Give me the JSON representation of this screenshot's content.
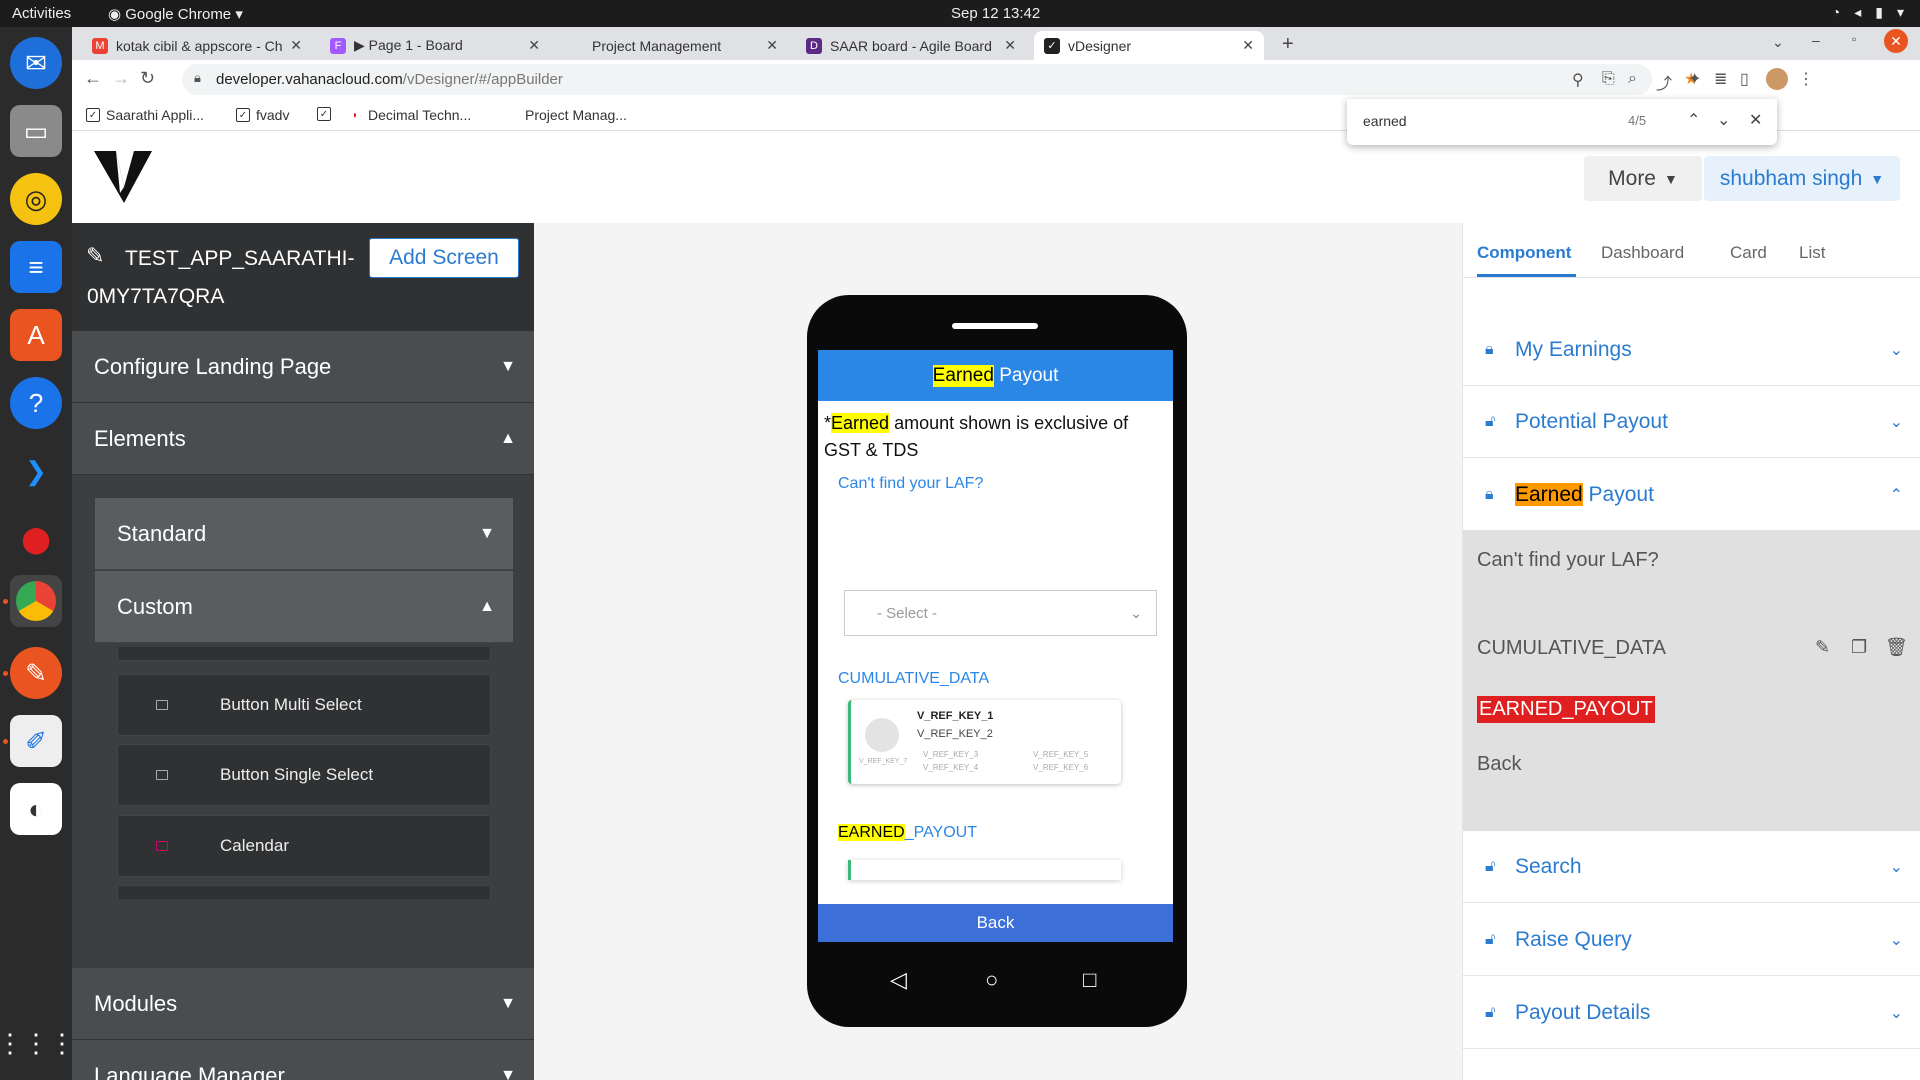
{
  "os": {
    "activities": "Activities",
    "app_name": "Google Chrome",
    "clock": "Sep 12  13:42"
  },
  "browser": {
    "tabs": [
      {
        "label": "kotak cibil & appscore - Ch",
        "favicon": "gmail-icon",
        "color": "#ea4335"
      },
      {
        "label": "▶ Page 1 - Board",
        "favicon": "figma-icon",
        "color": "#a259ff"
      },
      {
        "label": "Project Management",
        "favicon": "none",
        "color": "#cccccc"
      },
      {
        "label": "SAAR board - Agile Board",
        "favicon": "jira-icon",
        "color": "#5b2a86"
      },
      {
        "label": "vDesigner",
        "favicon": "vdesigner-icon",
        "color": "#222222"
      }
    ],
    "url_host": "developer.vahanacloud.com",
    "url_path": "/vDesigner/#/appBuilder",
    "bookmarks": [
      "Saarathi Appli...",
      "fvadv",
      "",
      "Decimal Techn...",
      "Project Manag..."
    ],
    "find": {
      "query": "earned",
      "count": "4/5"
    }
  },
  "header": {
    "more_label": "More",
    "user_label": "shubham singh"
  },
  "sidebar": {
    "app_name": "TEST_APP_SAARATHI-0MY7TA7QRA",
    "add_screen_label": "Add Screen",
    "sections": {
      "configure": "Configure Landing Page",
      "elements": "Elements",
      "standard": "Standard",
      "custom": "Custom",
      "modules": "Modules",
      "language": "Language Manager"
    },
    "elements": [
      {
        "label": "Button Multi Select",
        "icon": "button-icon"
      },
      {
        "label": "Button Single Select",
        "icon": "button-icon"
      },
      {
        "label": "Calendar",
        "icon": "calendar-icon"
      }
    ]
  },
  "phone": {
    "header_hl": "Earned",
    "header_rest": " Payout",
    "note_star": "*",
    "note_hl": "Earned",
    "note_rest": " amount shown is exclusive of GST & TDS",
    "laf_link": "Can't find your LAF?",
    "select_placeholder": "- Select -",
    "cumulative_label": "CUMULATIVE_DATA",
    "card": {
      "k1": "V_REF_KEY_1",
      "k2": "V_REF_KEY_2",
      "k3": "V_REF_KEY_3",
      "k4": "V_REF_KEY_4",
      "k5": "V_REF_KEY_5",
      "k6": "V_REF_KEY_6",
      "k7": "V_REF_KEY_7"
    },
    "ep_hl": "EARNED",
    "ep_rest": "_PAYOUT",
    "back_label": "Back"
  },
  "right_panel": {
    "tabs": [
      "Component",
      "Dashboard",
      "Card",
      "List"
    ],
    "accordions": {
      "my_earnings": "My Earnings",
      "potential_payout": "Potential Payout",
      "earned_hl": "Earned",
      "earned_rest": " Payout",
      "search": "Search",
      "raise_query": "Raise Query",
      "payout_details": "Payout Details"
    },
    "earned_items": {
      "laf": "Can't find your LAF?",
      "cumulative": "CUMULATIVE_DATA",
      "earned_payout": "EARNED_PAYOUT",
      "back": "Back"
    }
  },
  "colors": {
    "accent": "#2b7bd0",
    "highlight": "#ffff00",
    "highlight_active": "#ff9900",
    "selected_red": "#e02020"
  }
}
